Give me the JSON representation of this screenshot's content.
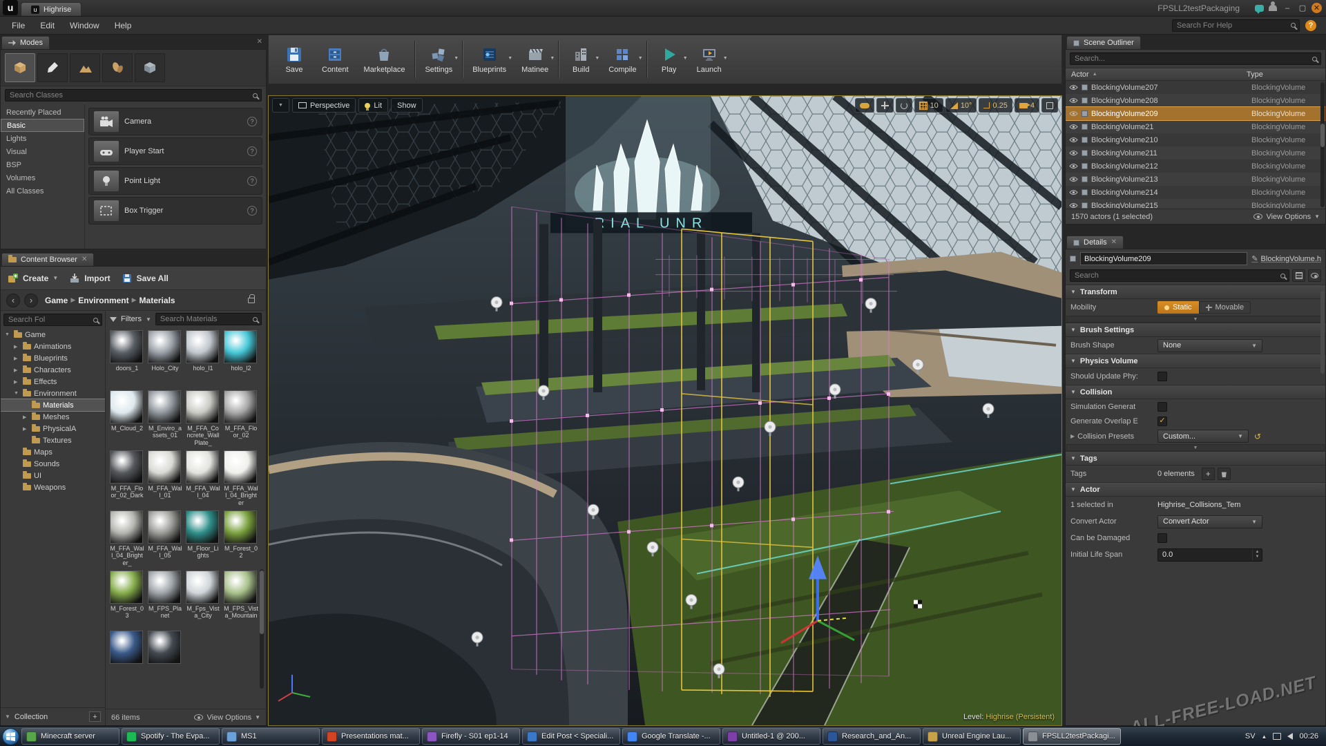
{
  "titlebar": {
    "tab": "Highrise",
    "title": "FPSLL2testPackaging",
    "help_search_placeholder": "Search For Help"
  },
  "menus": [
    {
      "label": "File"
    },
    {
      "label": "Edit"
    },
    {
      "label": "Window"
    },
    {
      "label": "Help"
    }
  ],
  "modes": {
    "tab_title": "Modes",
    "search_placeholder": "Search Classes",
    "categories": [
      {
        "label": "Recently Placed"
      },
      {
        "label": "Basic",
        "selected": true
      },
      {
        "label": "Lights"
      },
      {
        "label": "Visual"
      },
      {
        "label": "BSP"
      },
      {
        "label": "Volumes"
      },
      {
        "label": "All Classes"
      }
    ],
    "placeables": [
      {
        "label": "Camera"
      },
      {
        "label": "Player Start"
      },
      {
        "label": "Point Light"
      },
      {
        "label": "Box Trigger"
      }
    ]
  },
  "toolbar": {
    "save": "Save",
    "content": "Content",
    "marketplace": "Marketplace",
    "settings": "Settings",
    "blueprints": "Blueprints",
    "matinee": "Matinee",
    "build": "Build",
    "compile": "Compile",
    "play": "Play",
    "launch": "Launch"
  },
  "viewport": {
    "perspective_label": "Perspective",
    "lit_label": "Lit",
    "show_label": "Show",
    "grid_snap": "10",
    "rotation_snap": "10°",
    "scale_snap": "0.25",
    "camera_speed": "4",
    "sign_text": "RIAL UNR",
    "level_label": "Level:",
    "level_name": "Highrise (Persistent)"
  },
  "content_browser": {
    "tab_title": "Content Browser",
    "create_label": "Create",
    "import_label": "Import",
    "save_all_label": "Save All",
    "breadcrumb": [
      {
        "label": "Game"
      },
      {
        "label": "Environment"
      },
      {
        "label": "Materials"
      }
    ],
    "sources_search_placeholder": "Search Fol",
    "filters_label": "Filters",
    "asset_search_placeholder": "Search Materials",
    "tree": [
      {
        "label": "Game",
        "depth": 0,
        "arrow": "▼"
      },
      {
        "label": "Animations",
        "depth": 1,
        "arrow": "▶"
      },
      {
        "label": "Blueprints",
        "depth": 1,
        "arrow": "▶"
      },
      {
        "label": "Characters",
        "depth": 1,
        "arrow": "▶"
      },
      {
        "label": "Effects",
        "depth": 1,
        "arrow": "▶"
      },
      {
        "label": "Environment",
        "depth": 1,
        "arrow": "▼"
      },
      {
        "label": "Materials",
        "depth": 2,
        "arrow": "",
        "selected": true
      },
      {
        "label": "Meshes",
        "depth": 2,
        "arrow": "▶"
      },
      {
        "label": "PhysicalA",
        "depth": 2,
        "arrow": "▶"
      },
      {
        "label": "Textures",
        "depth": 2,
        "arrow": ""
      },
      {
        "label": "Maps",
        "depth": 1,
        "arrow": ""
      },
      {
        "label": "Sounds",
        "depth": 1,
        "arrow": ""
      },
      {
        "label": "UI",
        "depth": 1,
        "arrow": ""
      },
      {
        "label": "Weapons",
        "depth": 1,
        "arrow": ""
      }
    ],
    "assets": [
      {
        "name": "doors_1",
        "color": "#5a5f66"
      },
      {
        "name": "Holo_City",
        "color": "#9aa0a8"
      },
      {
        "name": "holo_l1",
        "color": "#c0c6cc"
      },
      {
        "name": "holo_l2",
        "color": "#46c8d8"
      },
      {
        "name": "M_Cloud_2",
        "color": "#dde8ee"
      },
      {
        "name": "M_Enviro_assets_01",
        "color": "#8f959c"
      },
      {
        "name": "M_FFA_Concrete_WallPlate_",
        "color": "#c9c9c4"
      },
      {
        "name": "M_FFA_Floor_02",
        "color": "#a8a8a8"
      },
      {
        "name": "M_FFA_Floor_02_Dark",
        "color": "#55585c"
      },
      {
        "name": "M_FFA_Wall_01",
        "color": "#d8d8d4"
      },
      {
        "name": "M_FFA_Wall_04",
        "color": "#e2e2de"
      },
      {
        "name": "M_FFA_Wall_04_Brighter",
        "color": "#efefec"
      },
      {
        "name": "M_FFA_Wall_04_Brighter_",
        "color": "#b4b4b0"
      },
      {
        "name": "M_FFA_Wall_05",
        "color": "#9b9b98"
      },
      {
        "name": "M_Floor_Lights",
        "color": "#2f8f8a"
      },
      {
        "name": "M_Forest_02",
        "color": "#7ba13f"
      },
      {
        "name": "M_Forest_03",
        "color": "#86ad4b"
      },
      {
        "name": "M_FPS_Planet",
        "color": "#9fa4a9"
      },
      {
        "name": "M_Fps_Vista_City",
        "color": "#cfd4d8"
      },
      {
        "name": "M_FPS_Vista_Mountain",
        "color": "#a8c08a"
      },
      {
        "name": "",
        "color": "#3a5a8a"
      },
      {
        "name": "",
        "color": "#444a52"
      }
    ],
    "items_count": "66 items",
    "view_options_label": "View Options",
    "collections_label": "Collection"
  },
  "outliner": {
    "tab_title": "Scene Outliner",
    "search_placeholder": "Search...",
    "col_actor": "Actor",
    "col_type": "Type",
    "rows": [
      {
        "name": "BlockingVolume207",
        "type": "BlockingVolume"
      },
      {
        "name": "BlockingVolume208",
        "type": "BlockingVolume"
      },
      {
        "name": "BlockingVolume209",
        "type": "BlockingVolume",
        "selected": true
      },
      {
        "name": "BlockingVolume21",
        "type": "BlockingVolume"
      },
      {
        "name": "BlockingVolume210",
        "type": "BlockingVolume"
      },
      {
        "name": "BlockingVolume211",
        "type": "BlockingVolume"
      },
      {
        "name": "BlockingVolume212",
        "type": "BlockingVolume"
      },
      {
        "name": "BlockingVolume213",
        "type": "BlockingVolume"
      },
      {
        "name": "BlockingVolume214",
        "type": "BlockingVolume"
      },
      {
        "name": "BlockingVolume215",
        "type": "BlockingVolume"
      }
    ],
    "status": "1570 actors (1 selected)",
    "view_options_label": "View Options"
  },
  "details": {
    "tab_title": "Details",
    "actor_name": "BlockingVolume209",
    "actor_class": "BlockingVolume.h",
    "search_placeholder": "Search",
    "transform_title": "Transform",
    "mobility_label": "Mobility",
    "mobility_static": "Static",
    "mobility_movable": "Movable",
    "brush_title": "Brush Settings",
    "brush_shape_label": "Brush Shape",
    "brush_shape_value": "None",
    "physics_title": "Physics Volume",
    "should_update_label": "Should Update Phy:",
    "collision_title": "Collision",
    "sim_generates_label": "Simulation Generat",
    "generate_overlap_label": "Generate Overlap E",
    "collision_presets_label": "Collision Presets",
    "collision_presets_value": "Custom...",
    "tags_title": "Tags",
    "tags_label": "Tags",
    "tags_value": "0 elements",
    "actor_title": "Actor",
    "selected_in_label": "1 selected in",
    "selected_in_value": "Highrise_Collisions_Tem",
    "convert_label": "Convert Actor",
    "convert_value": "Convert Actor",
    "damage_label": "Can be Damaged",
    "lifespan_label": "Initial Life Span",
    "lifespan_value": "0.0"
  },
  "taskbar": {
    "items": [
      {
        "label": "Minecraft server",
        "color": "#57a64a"
      },
      {
        "label": "Spotify - The Evpa...",
        "color": "#1db954"
      },
      {
        "label": "MS1",
        "color": "#6aa1d8"
      },
      {
        "label": "Presentations mat...",
        "color": "#d04423"
      },
      {
        "label": "Firefly - S01 ep1-14",
        "color": "#8a56c2"
      },
      {
        "label": "Edit Post < Speciali...",
        "color": "#3b78c8"
      },
      {
        "label": "Google Translate -...",
        "color": "#4285f4"
      },
      {
        "label": "Untitled-1 @ 200...",
        "color": "#7d3fa8"
      },
      {
        "label": "Research_and_An...",
        "color": "#2b579a"
      },
      {
        "label": "Unreal Engine Lau...",
        "color": "#c8a24a"
      },
      {
        "label": "FPSLL2testPackagi...",
        "color": "#8a8f96",
        "active": true
      }
    ],
    "lang": "SV",
    "time": "00:26"
  },
  "watermark": "ALL-FREE-LOAD.NET"
}
